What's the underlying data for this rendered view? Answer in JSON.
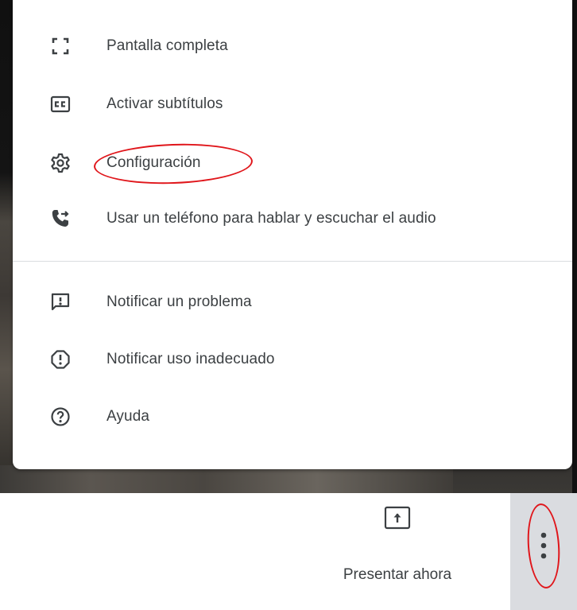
{
  "menu": {
    "items": [
      {
        "label": "Pantalla completa",
        "icon": "fullscreen-icon"
      },
      {
        "label": "Activar subtítulos",
        "icon": "closed-captions-icon"
      },
      {
        "label": "Configuración",
        "icon": "settings-gear-icon"
      },
      {
        "label": "Usar un teléfono para hablar y escuchar el audio",
        "icon": "phone-forward-icon"
      },
      {
        "label": "Notificar un problema",
        "icon": "report-problem-icon"
      },
      {
        "label": "Notificar uso inadecuado",
        "icon": "report-abuse-icon"
      },
      {
        "label": "Ayuda",
        "icon": "help-icon"
      }
    ]
  },
  "toolbar": {
    "present_label": "Presentar ahora",
    "present_icon": "present-screen-icon",
    "more_icon": "more-vert-icon"
  },
  "colors": {
    "annotation": "#e0161b",
    "text": "#3c4043",
    "more_button_bg": "#dadce0"
  }
}
